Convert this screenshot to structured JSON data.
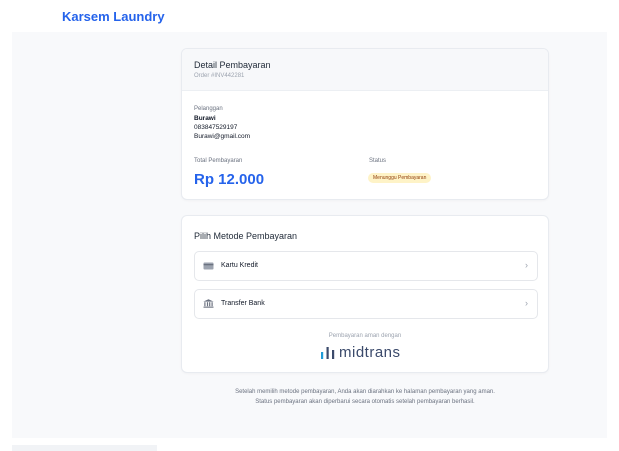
{
  "brand": "Karsem Laundry",
  "detail": {
    "title": "Detail Pembayaran",
    "order": "Order #INV442281",
    "customer_label": "Pelanggan",
    "customer_name": "Burawi",
    "customer_phone": "083847529197",
    "customer_email": "Burawi@gmail.com",
    "total_label": "Total Pembayaran",
    "total_value": "Rp 12.000",
    "status_label": "Status",
    "status_value": "Menunggu Pembayaran"
  },
  "methods": {
    "title": "Pilih Metode Pembayaran",
    "options": [
      {
        "label": "Kartu Kredit",
        "icon": "credit-card-icon"
      },
      {
        "label": "Transfer Bank",
        "icon": "bank-icon"
      }
    ],
    "secure_text": "Pembayaran aman dengan",
    "provider": "midtrans"
  },
  "notice": {
    "line1": "Setelah memilih metode pembayaran, Anda akan diarahkan ke halaman pembayaran yang aman.",
    "line2": "Status pembayaran akan diperbarui secara otomatis setelah pembayaran berhasil."
  },
  "colors": {
    "accent": "#2563eb",
    "badge_bg": "#fef3c7",
    "badge_text": "#92400e"
  }
}
